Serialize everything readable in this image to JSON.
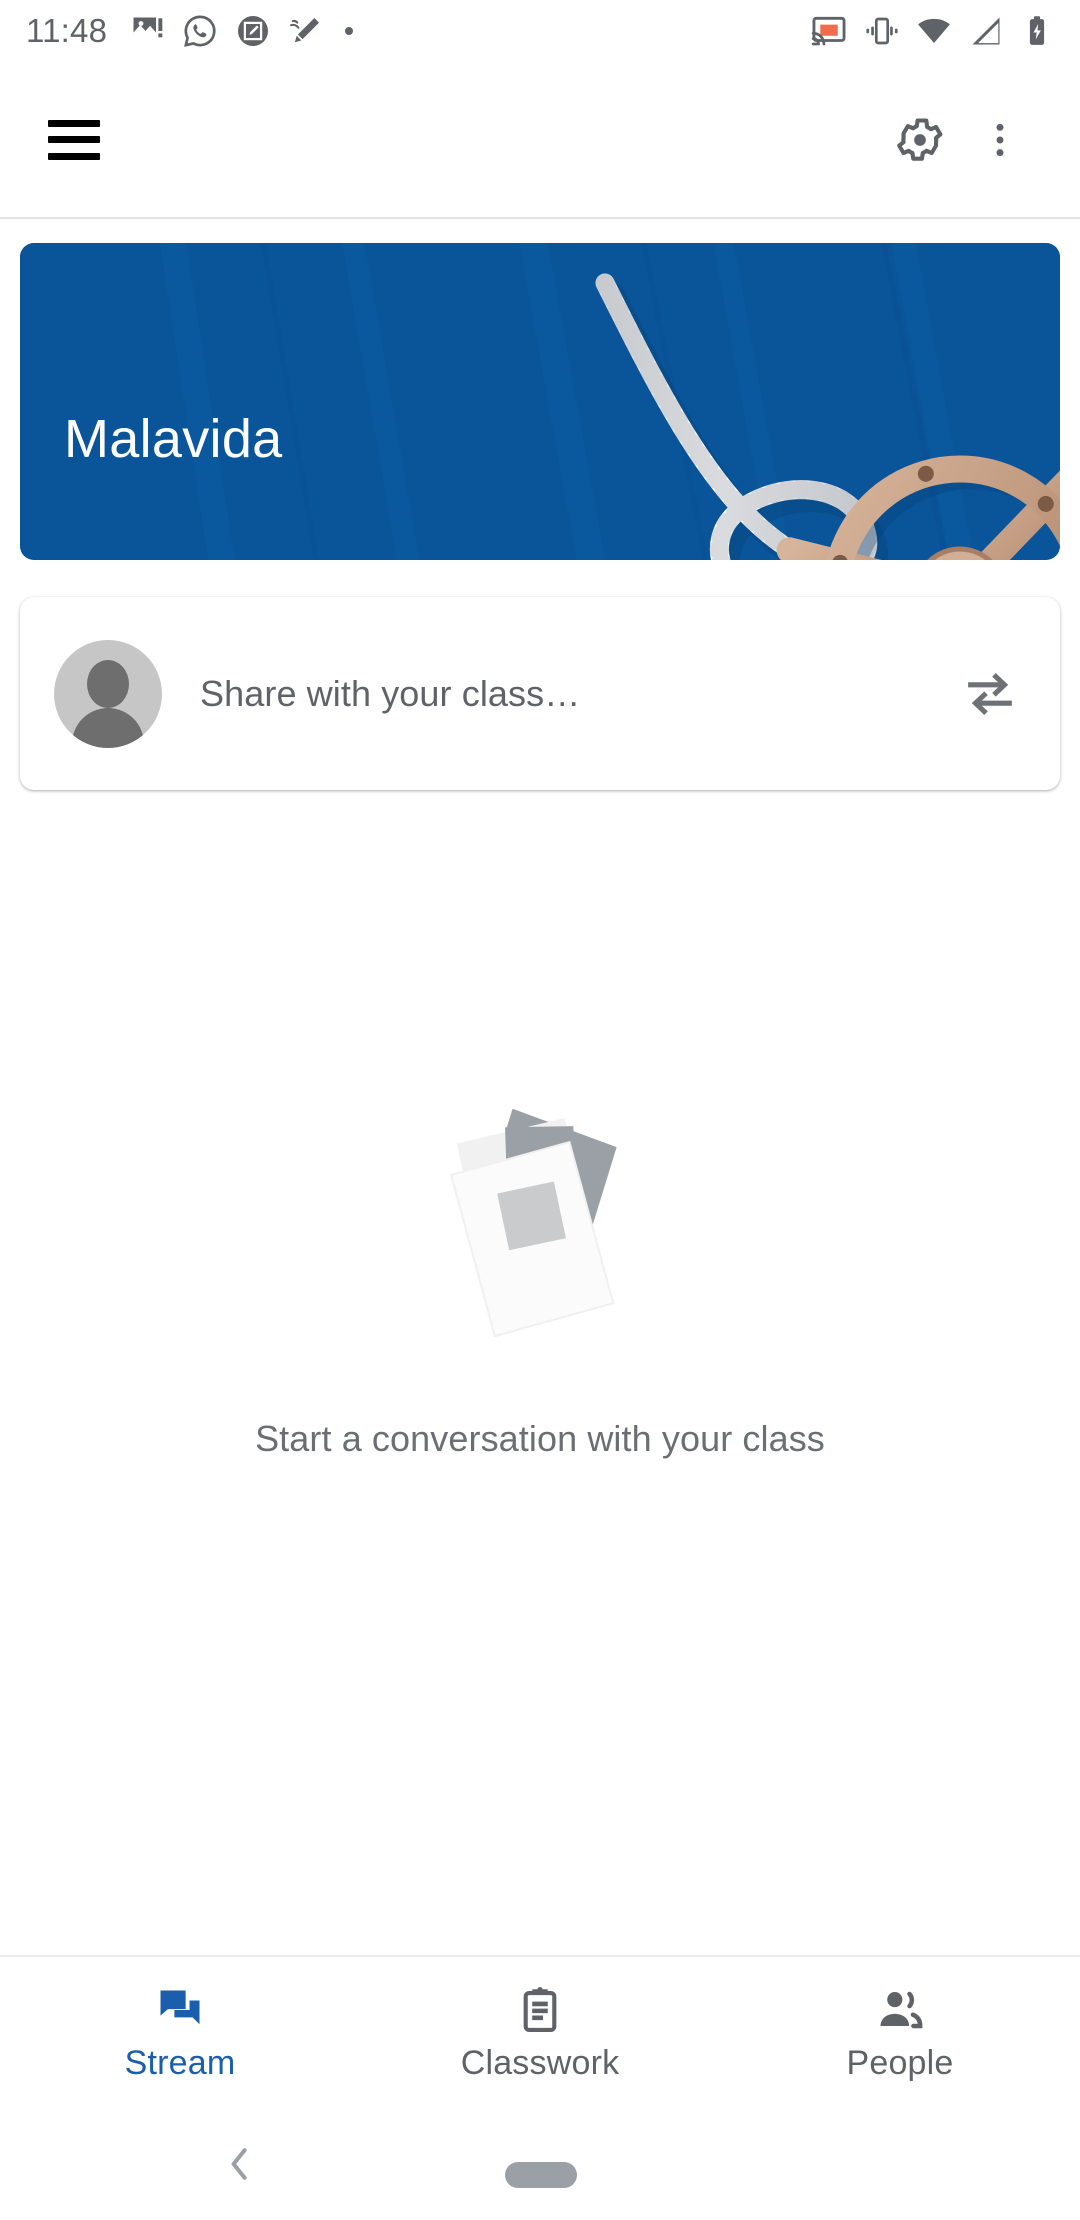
{
  "status_bar": {
    "time": "11:48",
    "left_icons": [
      {
        "name": "broken-image-icon",
        "label": "image error"
      },
      {
        "name": "whatsapp-icon",
        "label": "WhatsApp"
      },
      {
        "name": "screenshot-edit-icon",
        "label": "screenshot markup"
      },
      {
        "name": "stylus-icon",
        "label": "stylus"
      },
      {
        "name": "dot-icon",
        "label": "notification dot"
      }
    ],
    "right_icons": [
      {
        "name": "cast-icon",
        "label": "casting",
        "accent": "#ef6c4d"
      },
      {
        "name": "vibrate-icon",
        "label": "vibrate mode"
      },
      {
        "name": "wifi-icon",
        "label": "wifi full"
      },
      {
        "name": "cell-signal-icon",
        "label": "mobile signal"
      },
      {
        "name": "battery-charging-icon",
        "label": "battery charging"
      }
    ],
    "icon_color": "#5f6368"
  },
  "app_bar": {
    "menu_label": "Open navigation drawer",
    "settings_label": "Class settings",
    "overflow_label": "More options"
  },
  "banner": {
    "class_name": "Malavida",
    "theme": "nautical-helm",
    "background_color": "#0a559a",
    "rope_color": "#f1f2f2",
    "wheel_color": "#c9a88f"
  },
  "share_card": {
    "placeholder": "Share with your class…",
    "avatar_label": "Your profile photo",
    "attach_action_label": "Share with class"
  },
  "empty_state": {
    "message": "Start a conversation with your class",
    "illustration": "stacked-papers"
  },
  "bottom_nav": {
    "active_index": 0,
    "active_color": "#1b5eab",
    "inactive_color": "#5f6368",
    "items": [
      {
        "label": "Stream",
        "icon": "chat-bubbles-icon"
      },
      {
        "label": "Classwork",
        "icon": "clipboard-icon"
      },
      {
        "label": "People",
        "icon": "people-icon"
      }
    ]
  },
  "system_nav": {
    "back_label": "Back",
    "home_label": "Home"
  }
}
